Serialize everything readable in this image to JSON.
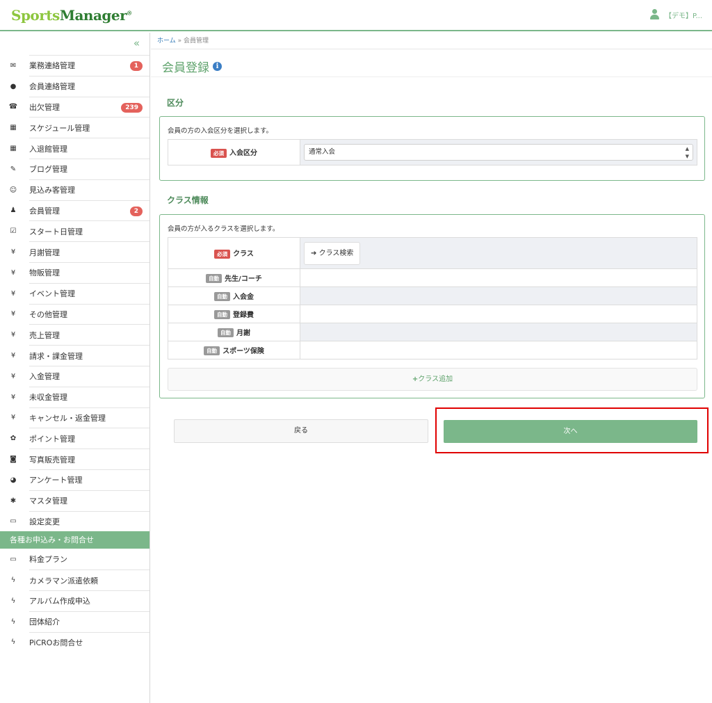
{
  "header": {
    "logo_part1": "Sports",
    "logo_part2": "Manager",
    "logo_mark": "®",
    "user_label": "【デモ】P..."
  },
  "sidebar": {
    "collapse_glyph": "«",
    "items": [
      {
        "icon": "envelope-icon",
        "glyph": "✉",
        "label": "業務連絡管理",
        "badge": "1"
      },
      {
        "icon": "comment-icon",
        "glyph": "●",
        "label": "会員連絡管理",
        "badge": ""
      },
      {
        "icon": "phone-icon",
        "glyph": "☎",
        "label": "出欠管理",
        "badge": "239"
      },
      {
        "icon": "calendar-icon",
        "glyph": "▦",
        "label": "スケジュール管理",
        "badge": ""
      },
      {
        "icon": "calendar-icon",
        "glyph": "▦",
        "label": "入退館管理",
        "badge": ""
      },
      {
        "icon": "pencil-icon",
        "glyph": "✎",
        "label": "ブログ管理",
        "badge": ""
      },
      {
        "icon": "smile-icon",
        "glyph": "☺",
        "label": "見込み客管理",
        "badge": ""
      },
      {
        "icon": "user-icon",
        "glyph": "♟",
        "label": "会員管理",
        "badge": "2"
      },
      {
        "icon": "check-square-icon",
        "glyph": "☑",
        "label": "スタート日管理",
        "badge": ""
      },
      {
        "icon": "yen-icon",
        "glyph": "¥",
        "label": "月謝管理",
        "badge": ""
      },
      {
        "icon": "yen-icon",
        "glyph": "¥",
        "label": "物販管理",
        "badge": ""
      },
      {
        "icon": "yen-icon",
        "glyph": "¥",
        "label": "イベント管理",
        "badge": ""
      },
      {
        "icon": "yen-icon",
        "glyph": "¥",
        "label": "その他管理",
        "badge": ""
      },
      {
        "icon": "yen-icon",
        "glyph": "¥",
        "label": "売上管理",
        "badge": ""
      },
      {
        "icon": "yen-icon",
        "glyph": "¥",
        "label": "請求・課金管理",
        "badge": ""
      },
      {
        "icon": "yen-icon",
        "glyph": "¥",
        "label": "入金管理",
        "badge": ""
      },
      {
        "icon": "yen-icon",
        "glyph": "¥",
        "label": "未収金管理",
        "badge": ""
      },
      {
        "icon": "yen-icon",
        "glyph": "¥",
        "label": "キャンセル・返金管理",
        "badge": ""
      },
      {
        "icon": "gift-icon",
        "glyph": "✿",
        "label": "ポイント管理",
        "badge": ""
      },
      {
        "icon": "camera-icon",
        "glyph": "◙",
        "label": "写真販売管理",
        "badge": ""
      },
      {
        "icon": "dashboard-icon",
        "glyph": "◕",
        "label": "アンケート管理",
        "badge": ""
      },
      {
        "icon": "cog-icon",
        "glyph": "✱",
        "label": "マスタ管理",
        "badge": ""
      },
      {
        "icon": "desktop-icon",
        "glyph": "▭",
        "label": "設定変更",
        "badge": ""
      }
    ],
    "section_label": "各種お申込み・お問合せ",
    "section_items": [
      {
        "icon": "desktop-icon",
        "glyph": "▭",
        "label": "料金プラン"
      },
      {
        "icon": "bolt-icon",
        "glyph": "ϟ",
        "label": "カメラマン派遣依頼"
      },
      {
        "icon": "bolt-icon",
        "glyph": "ϟ",
        "label": "アルバム作成申込"
      },
      {
        "icon": "bolt-icon",
        "glyph": "ϟ",
        "label": "団体紹介"
      },
      {
        "icon": "bolt-icon",
        "glyph": "ϟ",
        "label": "PiCROお問合せ"
      }
    ]
  },
  "breadcrumb": {
    "home": "ホーム",
    "separator": "»",
    "current": "会員管理"
  },
  "page": {
    "title": "会員登録",
    "info_glyph": "i"
  },
  "section1": {
    "title": "区分",
    "desc": "会員の方の入会区分を選択します。",
    "required_tag": "必須",
    "field_label": "入会区分",
    "select_value": "通常入会"
  },
  "section2": {
    "title": "クラス情報",
    "desc": "会員の方が入るクラスを選択します。",
    "required_tag": "必須",
    "class_label": "クラス",
    "search_button": "クラス検索",
    "auto_tag": "自動",
    "auto_rows": [
      "先生/コーチ",
      "入会金",
      "登録費",
      "月謝",
      "スポーツ保険"
    ],
    "add_class": "クラス追加"
  },
  "actions": {
    "back": "戻る",
    "next": "次へ"
  }
}
